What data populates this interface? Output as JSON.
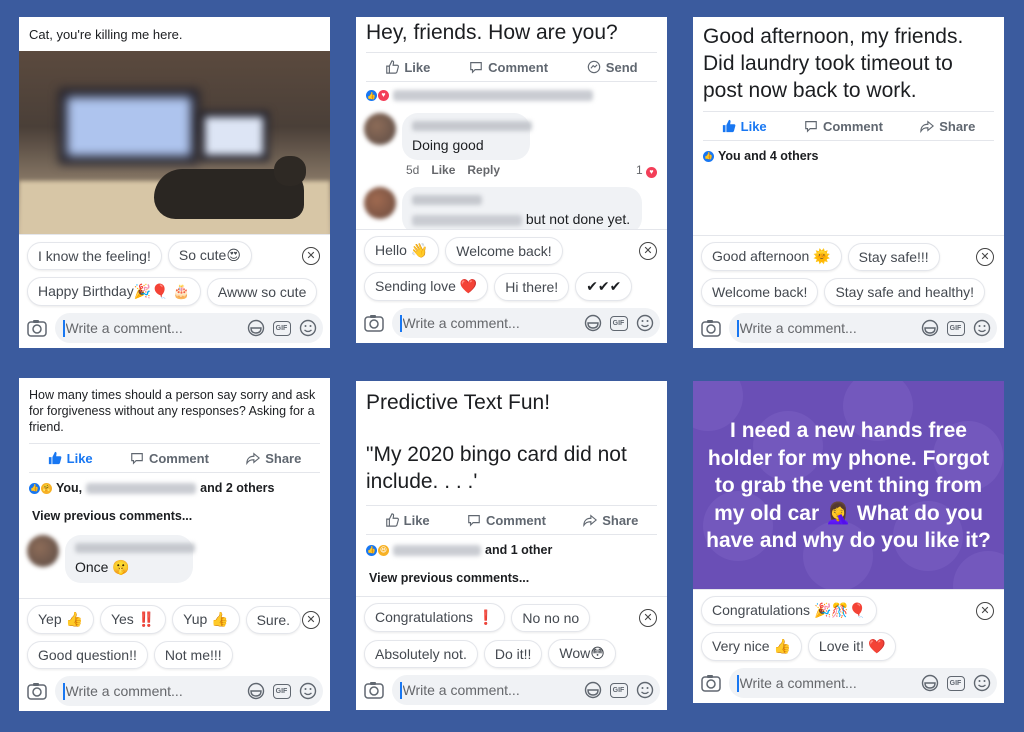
{
  "comment_placeholder": "Write a comment...",
  "panels": [
    {
      "post_text": "Cat, you're killing me here.",
      "suggestions_row1": [
        "I know the feeling!",
        "So cute😍"
      ],
      "suggestions_row2": [
        "Happy Birthday🎉🎈 🎂",
        "Awww so cute"
      ]
    },
    {
      "post_text": "Hey, friends. How are you?",
      "actions": [
        "Like",
        "Comment",
        "Send"
      ],
      "comments": [
        {
          "text": "Doing good",
          "time": "5d",
          "like": "Like",
          "reply": "Reply",
          "reaction_count": "1"
        },
        {
          "text": "but not done yet."
        }
      ],
      "suggestions_row1": [
        "Hello 👋",
        "Welcome back!"
      ],
      "suggestions_row2": [
        "Sending love ❤️",
        "Hi there!",
        "✔✔✔"
      ]
    },
    {
      "post_text": "Good afternoon, my friends. Did laundry took timeout to post now back to work.",
      "actions": [
        "Like",
        "Comment",
        "Share"
      ],
      "reactions_text": "You and 4 others",
      "suggestions_row1": [
        "Good afternoon 🌞",
        "Stay safe!!!"
      ],
      "suggestions_row2": [
        "Welcome back!",
        "Stay safe and healthy!"
      ]
    },
    {
      "post_text": "How many times should a person say sorry and ask for forgiveness without any responses? Asking for a friend.",
      "actions": [
        "Like",
        "Comment",
        "Share"
      ],
      "reactions_prefix": "You,",
      "reactions_suffix": "and 2 others",
      "view_previous": "View previous comments...",
      "comments": [
        {
          "text": "Once 🤫"
        }
      ],
      "suggestions_row1": [
        "Yep 👍",
        "Yes ‼️",
        "Yup 👍",
        "Sure."
      ],
      "suggestions_row2": [
        "Good question!!",
        "Not me!!!"
      ]
    },
    {
      "post_text_line1": "Predictive Text Fun!",
      "post_text_line2": "\"My 2020 bingo card did not include. . . .'",
      "actions": [
        "Like",
        "Comment",
        "Share"
      ],
      "reactions_suffix": "and 1 other",
      "view_previous": "View previous comments...",
      "suggestions_row1": [
        "Congratulations ❗",
        "No no no"
      ],
      "suggestions_row2": [
        "Absolutely not.",
        "Do it!!",
        "Wow😳"
      ]
    },
    {
      "post_text": "I need a new hands free holder for my phone. Forgot to grab the vent thing from my old car 🤦‍♀️ What do you have and why do you like it?",
      "background_color": "#6a4fb6",
      "suggestions_row1": [
        "Congratulations 🎉🎊🎈"
      ],
      "suggestions_row2": [
        "Very nice 👍",
        "Love it! ❤️"
      ]
    }
  ],
  "colors": {
    "page_background": "#3b5b9e",
    "facebook_blue": "#1877f2",
    "love_red": "#f33e58"
  }
}
